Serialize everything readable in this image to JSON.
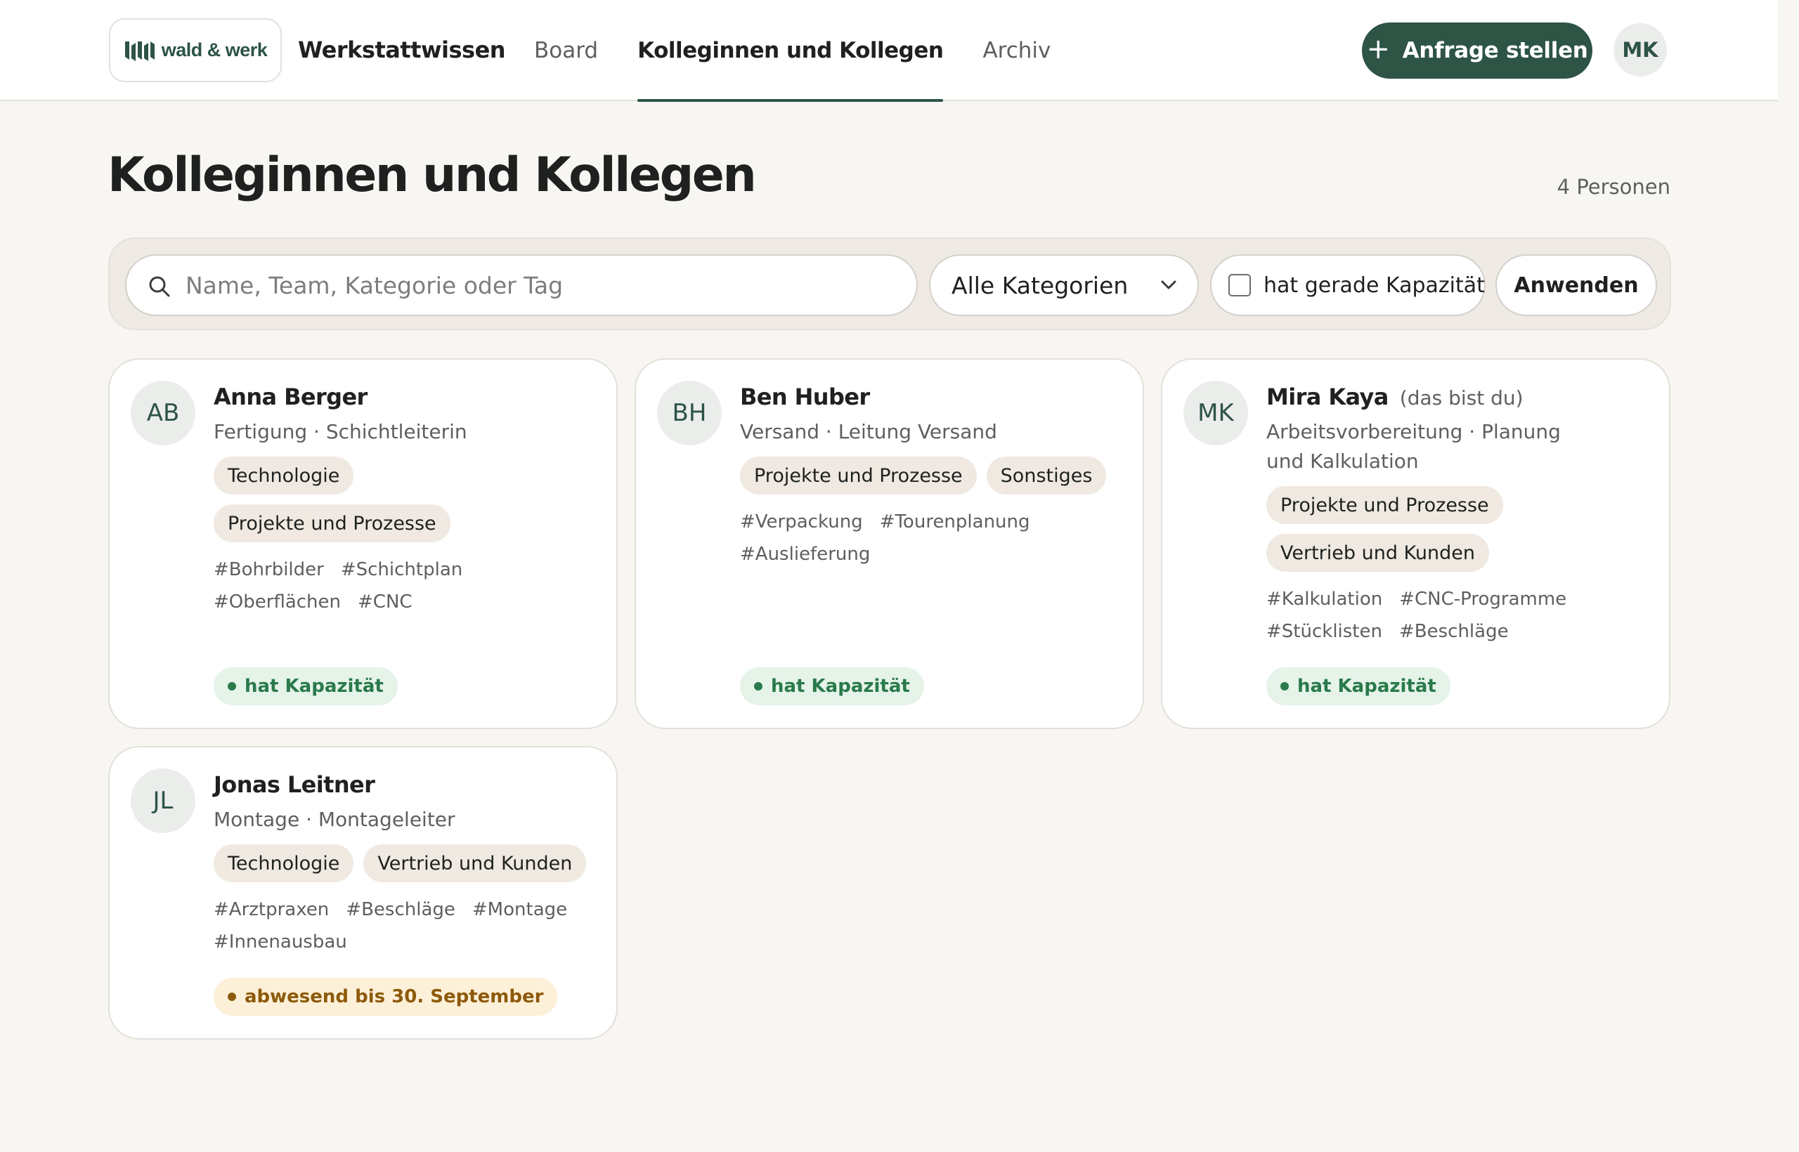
{
  "header": {
    "logo_text": "wald & werk",
    "app_title": "Werkstattwissen",
    "nav": [
      {
        "label": "Board",
        "active": false
      },
      {
        "label": "Kolleginnen und Kollegen",
        "active": true
      },
      {
        "label": "Archiv",
        "active": false
      }
    ],
    "cta_label": "Anfrage stellen",
    "cta_icon": "plus-icon",
    "user_initials": "MK"
  },
  "page": {
    "title": "Kolleginnen und Kollegen",
    "count": "4 Personen"
  },
  "filters": {
    "search_placeholder": "Name, Team, Kategorie oder Tag",
    "search_value": "",
    "category_selected": "Alle Kategorien",
    "capacity_label": "hat gerade Kapazität",
    "capacity_checked": false,
    "apply_label": "Anwenden"
  },
  "colors": {
    "brand": "#2d5445",
    "background": "#f8f6f2",
    "status_available": "#2a7a4b",
    "status_away": "#8d5a0a"
  },
  "people": [
    {
      "initials": "AB",
      "name": "Anna Berger",
      "you_label": "",
      "team": "Fertigung",
      "role": "Schichtleiterin",
      "categories": [
        "Technologie",
        "Projekte und Prozesse"
      ],
      "tags": [
        "#Bohrbilder",
        "#Schichtplan",
        "#Oberflächen",
        "#CNC"
      ],
      "status": "hat Kapazität",
      "status_type": "available"
    },
    {
      "initials": "BH",
      "name": "Ben Huber",
      "you_label": "",
      "team": "Versand",
      "role": "Leitung Versand",
      "categories": [
        "Projekte und Prozesse",
        "Sonstiges"
      ],
      "tags": [
        "#Verpackung",
        "#Tourenplanung",
        "#Auslieferung"
      ],
      "status": "hat Kapazität",
      "status_type": "available"
    },
    {
      "initials": "MK",
      "name": "Mira Kaya",
      "you_label": "(das bist du)",
      "team": "Arbeitsvorbereitung",
      "role": "Planung und Kalkulation",
      "categories": [
        "Projekte und Prozesse",
        "Vertrieb und Kunden"
      ],
      "tags": [
        "#Kalkulation",
        "#CNC-Programme",
        "#Stücklisten",
        "#Beschläge"
      ],
      "status": "hat Kapazität",
      "status_type": "available"
    },
    {
      "initials": "JL",
      "name": "Jonas Leitner",
      "you_label": "",
      "team": "Montage",
      "role": "Montageleiter",
      "categories": [
        "Technologie",
        "Vertrieb und Kunden"
      ],
      "tags": [
        "#Arztpraxen",
        "#Beschläge",
        "#Montage",
        "#Innenausbau"
      ],
      "status": "abwesend bis 30. September",
      "status_type": "away"
    }
  ]
}
